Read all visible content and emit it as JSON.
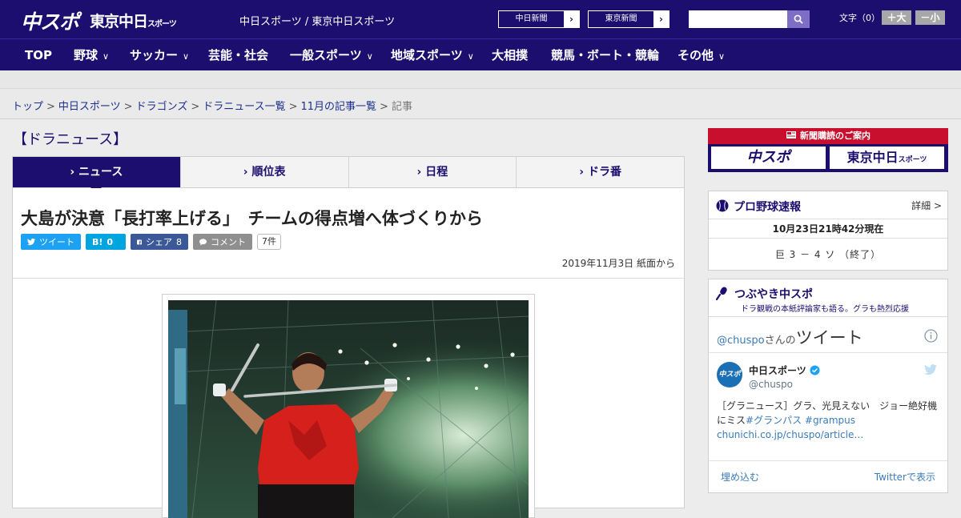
{
  "header": {
    "logo_chuspo": "中スポ",
    "logo_tokyo": "東京中日",
    "logo_tokyo_small": "スポーツ",
    "site_name": "中日スポーツ / 東京中日スポーツ",
    "link_chunichi": "中日新聞",
    "link_tokyo": "東京新聞",
    "search_placeholder": "",
    "fontsize_label": "文字（0）",
    "fs_larger": "＋大",
    "fs_smaller": "－小",
    "accent": "#1b0e6e"
  },
  "nav": [
    {
      "label": "TOP",
      "chevron": false
    },
    {
      "label": "野球",
      "chevron": true
    },
    {
      "label": "サッカー",
      "chevron": true
    },
    {
      "label": "芸能・社会",
      "chevron": false
    },
    {
      "label": "一般スポーツ",
      "chevron": true
    },
    {
      "label": "地域スポーツ",
      "chevron": true
    },
    {
      "label": "大相撲",
      "chevron": false
    },
    {
      "label": "競馬・ボート・競輪",
      "chevron": false
    },
    {
      "label": "その他",
      "chevron": true
    }
  ],
  "breadcrumb": {
    "items": [
      "トップ",
      "中日スポーツ",
      "ドラゴンズ",
      "ドラニュース一覧",
      "11月の記事一覧"
    ],
    "current": "記事",
    "separator": ">"
  },
  "section_title": "【ドラニュース】",
  "tabs": [
    {
      "label": "ニュース",
      "active": true
    },
    {
      "label": "順位表",
      "active": false
    },
    {
      "label": "日程",
      "active": false
    },
    {
      "label": "ドラ番",
      "active": false
    }
  ],
  "article": {
    "title": "大島が決意「長打率上げる」　チームの得点増へ体づくりから",
    "share": {
      "tweet": "ツイート",
      "hatena_label": "B!",
      "hatena_count": "0",
      "facebook": "シェア",
      "facebook_count": "8",
      "comment": "コメント",
      "comment_count": "7件"
    },
    "date": "2019年11月3日 紙面から"
  },
  "sidebar": {
    "ad_header": "新聞購読のご案内",
    "ad_logo_chuspo": "中スポ",
    "ad_logo_tokyo": "東京中日",
    "ad_logo_tokyo_small": "スポーツ",
    "baseball": {
      "title": "プロ野球速報",
      "detail": "詳細 >",
      "time": "10月23日21時42分現在",
      "score": "巨 3 － 4 ソ （終了）"
    },
    "tweets": {
      "title": "つぶやき中スポ",
      "subtitle": "ドラ観戦の本紙評論家も語る。グラも熱烈応援",
      "handle_prefix": "@chuspo",
      "handle_suffix": "さんの",
      "tweet_word": "ツイート",
      "user_name": "中日スポーツ",
      "user_handle": "@chuspo",
      "avatar_text": "中スポ",
      "tweet_text": "［グラニュース］グラ、光見えない　ジョー絶好機にミス",
      "tweet_hashtags": "#グランパス #grampus",
      "tweet_link": "chunichi.co.jp/chuspo/article…",
      "embed": "埋め込む",
      "view_on": "Twitterで表示"
    }
  }
}
